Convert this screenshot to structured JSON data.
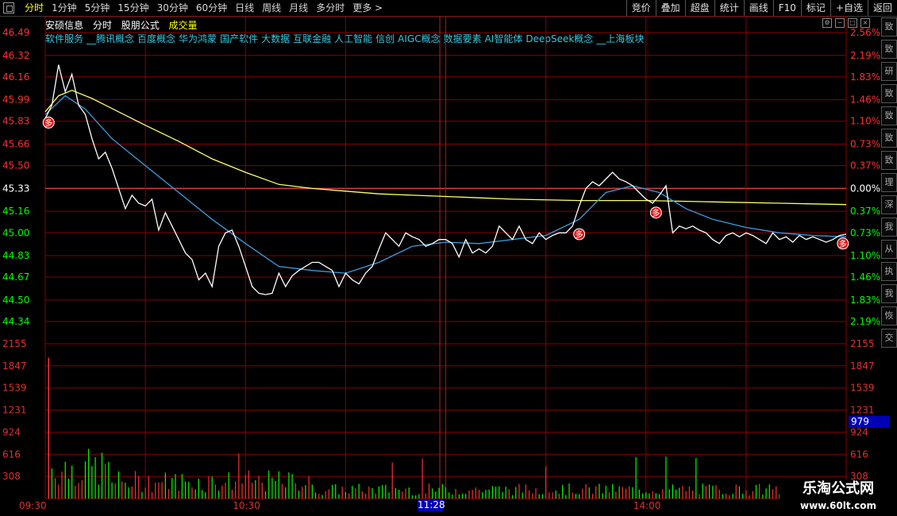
{
  "toolbar": {
    "periods": [
      "分时",
      "1分钟",
      "5分钟",
      "15分钟",
      "30分钟",
      "60分钟",
      "日线",
      "周线",
      "月线",
      "多分时",
      "更多 >"
    ],
    "active_period": "分时",
    "buttons": [
      "竞价",
      "叠加",
      "超盘",
      "统计",
      "画线",
      "F10",
      "标记",
      "+自选",
      "返回"
    ]
  },
  "stock": {
    "name": "安硕信息",
    "chart_mode": "分时",
    "formula_label": "股朋公式",
    "volume_label": "成交量"
  },
  "concepts": [
    "软件服务",
    "__腾讯概念",
    "百度概念",
    "华为鸿蒙",
    "国产软件",
    "大数据",
    "互联金融",
    "人工智能",
    "信创",
    "AIGC概念",
    "数据要素",
    "AI智能体",
    "DeepSeek概念",
    "__上海板块"
  ],
  "side_tabs": [
    "致",
    "致",
    "研",
    "致",
    "致",
    "致",
    "致",
    "理",
    "深",
    "我",
    "从",
    "执",
    "我",
    "恢",
    "交"
  ],
  "watermark": {
    "name": "乐淘公式网",
    "url": "www.60lt.com"
  },
  "colors": {
    "up": "#ff3030",
    "down": "#00ff00",
    "grid": "#8b0000",
    "price_line": "#ffffff",
    "avg_line": "#ffff66",
    "ma_line": "#3a9de0",
    "cyan": "#34c8e0"
  },
  "chart_data": {
    "type": "line",
    "title": "",
    "price_axis": {
      "left_ticks": [
        "46.49",
        "46.32",
        "46.16",
        "45.99",
        "45.83",
        "45.66",
        "45.50",
        "45.33",
        "45.16",
        "45.00",
        "44.83",
        "44.67",
        "44.50",
        "44.34"
      ],
      "right_ticks": [
        "2.56%",
        "2.19%",
        "1.83%",
        "1.46%",
        "1.10%",
        "0.73%",
        "0.37%",
        "0.00%",
        "0.37%",
        "0.73%",
        "1.10%",
        "1.46%",
        "1.83%",
        "2.19%"
      ],
      "prev_close": 45.33,
      "ylim": [
        44.34,
        46.49
      ]
    },
    "volume_axis": {
      "ticks": [
        "2155",
        "1847",
        "1539",
        "1231",
        "924",
        "616",
        "308"
      ],
      "ylim": [
        0,
        2155
      ],
      "current_volume": "979"
    },
    "time_axis": {
      "ticks": [
        "09:30",
        "10:30",
        "11:28",
        "14:00"
      ],
      "cursor_time": "11:28",
      "total_minutes": 240
    },
    "series": [
      {
        "name": "price",
        "points": [
          [
            0,
            45.85
          ],
          [
            2,
            45.95
          ],
          [
            4,
            46.25
          ],
          [
            6,
            46.05
          ],
          [
            8,
            46.18
          ],
          [
            10,
            45.95
          ],
          [
            12,
            45.88
          ],
          [
            14,
            45.7
          ],
          [
            16,
            45.55
          ],
          [
            18,
            45.6
          ],
          [
            20,
            45.48
          ],
          [
            22,
            45.33
          ],
          [
            24,
            45.18
          ],
          [
            26,
            45.28
          ],
          [
            28,
            45.22
          ],
          [
            30,
            45.2
          ],
          [
            32,
            45.25
          ],
          [
            34,
            45.02
          ],
          [
            36,
            45.15
          ],
          [
            38,
            45.05
          ],
          [
            40,
            44.95
          ],
          [
            42,
            44.85
          ],
          [
            44,
            44.8
          ],
          [
            46,
            44.65
          ],
          [
            48,
            44.7
          ],
          [
            50,
            44.6
          ],
          [
            52,
            44.9
          ],
          [
            54,
            45.0
          ],
          [
            56,
            45.02
          ],
          [
            58,
            44.9
          ],
          [
            60,
            44.75
          ],
          [
            62,
            44.6
          ],
          [
            64,
            44.55
          ],
          [
            66,
            44.54
          ],
          [
            68,
            44.55
          ],
          [
            70,
            44.7
          ],
          [
            72,
            44.6
          ],
          [
            74,
            44.68
          ],
          [
            76,
            44.72
          ],
          [
            78,
            44.75
          ],
          [
            80,
            44.78
          ],
          [
            82,
            44.78
          ],
          [
            84,
            44.75
          ],
          [
            86,
            44.72
          ],
          [
            88,
            44.6
          ],
          [
            90,
            44.7
          ],
          [
            92,
            44.65
          ],
          [
            94,
            44.62
          ],
          [
            96,
            44.7
          ],
          [
            98,
            44.75
          ],
          [
            100,
            44.88
          ],
          [
            102,
            45.0
          ],
          [
            104,
            44.95
          ],
          [
            106,
            44.9
          ],
          [
            108,
            45.0
          ],
          [
            110,
            44.97
          ],
          [
            112,
            44.95
          ],
          [
            114,
            44.9
          ],
          [
            116,
            44.92
          ],
          [
            118,
            44.95
          ],
          [
            120,
            44.95
          ],
          [
            122,
            44.92
          ],
          [
            124,
            44.82
          ],
          [
            126,
            44.95
          ],
          [
            128,
            44.85
          ],
          [
            130,
            44.88
          ],
          [
            132,
            44.85
          ],
          [
            134,
            44.9
          ],
          [
            136,
            45.05
          ],
          [
            138,
            45.0
          ],
          [
            140,
            44.95
          ],
          [
            142,
            45.05
          ],
          [
            144,
            44.95
          ],
          [
            146,
            44.92
          ],
          [
            148,
            45.0
          ],
          [
            150,
            44.95
          ],
          [
            152,
            44.98
          ],
          [
            154,
            45.0
          ],
          [
            156,
            45.0
          ],
          [
            158,
            45.05
          ],
          [
            160,
            45.2
          ],
          [
            162,
            45.33
          ],
          [
            164,
            45.38
          ],
          [
            166,
            45.35
          ],
          [
            168,
            45.4
          ],
          [
            170,
            45.45
          ],
          [
            172,
            45.4
          ],
          [
            174,
            45.38
          ],
          [
            176,
            45.35
          ],
          [
            178,
            45.3
          ],
          [
            180,
            45.25
          ],
          [
            182,
            45.22
          ],
          [
            184,
            45.28
          ],
          [
            186,
            45.35
          ],
          [
            188,
            45.0
          ],
          [
            190,
            45.05
          ],
          [
            192,
            45.03
          ],
          [
            194,
            45.05
          ],
          [
            196,
            45.02
          ],
          [
            198,
            45.0
          ],
          [
            200,
            44.95
          ],
          [
            202,
            44.92
          ],
          [
            204,
            44.98
          ],
          [
            206,
            45.0
          ],
          [
            208,
            44.97
          ],
          [
            210,
            45.0
          ],
          [
            212,
            44.98
          ],
          [
            214,
            44.95
          ],
          [
            216,
            44.92
          ],
          [
            218,
            45.0
          ],
          [
            220,
            44.95
          ],
          [
            222,
            44.97
          ],
          [
            224,
            44.93
          ],
          [
            226,
            44.98
          ],
          [
            228,
            44.95
          ],
          [
            230,
            44.97
          ],
          [
            232,
            44.95
          ],
          [
            234,
            44.93
          ],
          [
            236,
            44.95
          ],
          [
            238,
            44.98
          ],
          [
            240,
            44.99
          ]
        ]
      },
      {
        "name": "average",
        "points": [
          [
            0,
            45.9
          ],
          [
            4,
            46.02
          ],
          [
            8,
            46.06
          ],
          [
            14,
            46.0
          ],
          [
            22,
            45.9
          ],
          [
            30,
            45.8
          ],
          [
            40,
            45.68
          ],
          [
            50,
            45.55
          ],
          [
            60,
            45.45
          ],
          [
            70,
            45.36
          ],
          [
            80,
            45.33
          ],
          [
            90,
            45.31
          ],
          [
            100,
            45.29
          ],
          [
            110,
            45.28
          ],
          [
            120,
            45.27
          ],
          [
            130,
            45.26
          ],
          [
            140,
            45.25
          ],
          [
            160,
            45.24
          ],
          [
            180,
            45.24
          ],
          [
            200,
            45.23
          ],
          [
            220,
            45.22
          ],
          [
            240,
            45.21
          ]
        ]
      },
      {
        "name": "ma",
        "points": [
          [
            0,
            45.88
          ],
          [
            6,
            46.02
          ],
          [
            12,
            45.92
          ],
          [
            20,
            45.7
          ],
          [
            30,
            45.5
          ],
          [
            40,
            45.3
          ],
          [
            50,
            45.1
          ],
          [
            60,
            44.92
          ],
          [
            70,
            44.75
          ],
          [
            80,
            44.72
          ],
          [
            90,
            44.7
          ],
          [
            100,
            44.78
          ],
          [
            110,
            44.9
          ],
          [
            120,
            44.93
          ],
          [
            130,
            44.92
          ],
          [
            140,
            44.95
          ],
          [
            150,
            44.98
          ],
          [
            160,
            45.1
          ],
          [
            168,
            45.3
          ],
          [
            176,
            45.35
          ],
          [
            184,
            45.3
          ],
          [
            192,
            45.18
          ],
          [
            200,
            45.1
          ],
          [
            210,
            45.04
          ],
          [
            220,
            45.0
          ],
          [
            230,
            44.98
          ],
          [
            240,
            44.97
          ]
        ]
      }
    ],
    "markers": [
      {
        "label": "多",
        "t": 1,
        "price": 45.82
      },
      {
        "label": "多",
        "t": 160,
        "price": 44.99
      },
      {
        "label": "多",
        "t": 183,
        "price": 45.15
      },
      {
        "label": "多",
        "t": 239,
        "price": 44.92
      }
    ],
    "volume_first_bar": 1960
  }
}
